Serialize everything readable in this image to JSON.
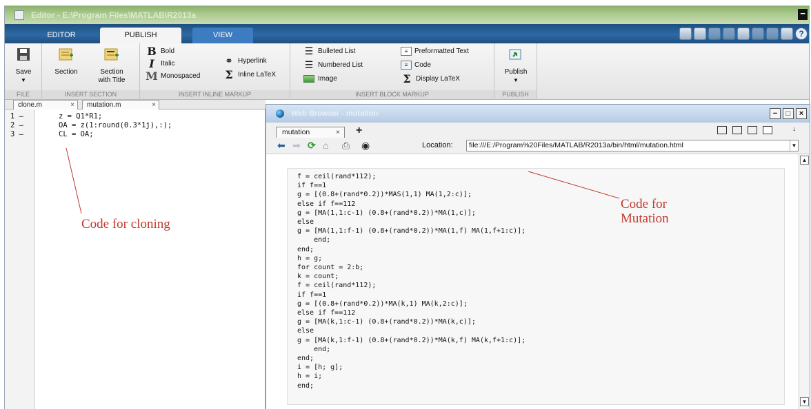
{
  "window": {
    "title": "Editor - E:\\Program Files\\MATLAB\\R2013a"
  },
  "ribbon_tabs": [
    "EDITOR",
    "PUBLISH",
    "VIEW"
  ],
  "ribbon": {
    "file": {
      "save": "Save",
      "label": "FILE"
    },
    "insert_section": {
      "section": "Section",
      "section_with_title_1": "Section",
      "section_with_title_2": "with Title",
      "label": "INSERT SECTION"
    },
    "inline_markup": {
      "bold": "Bold",
      "italic": "Italic",
      "monospaced": "Monospaced",
      "hyperlink": "Hyperlink",
      "inline_latex": "Inline LaTeX",
      "label": "INSERT INLINE MARKUP"
    },
    "block_markup": {
      "bulleted_list": "Bulleted List",
      "numbered_list": "Numbered List",
      "image": "Image",
      "preformatted_text": "Preformatted Text",
      "code": "Code",
      "display_latex": "Display LaTeX",
      "label": "INSERT BLOCK MARKUP"
    },
    "publish": {
      "publish": "Publish",
      "label": "PUBLISH"
    }
  },
  "doc_tabs": [
    "clone.m",
    "mutation.m"
  ],
  "editor": {
    "line_numbers": [
      "1 —",
      "2 —",
      "3 —"
    ],
    "lines": [
      "z = Q1*R1;",
      "OA = z(1:round(0.3*1j),:);",
      "CL = OA;"
    ]
  },
  "browser": {
    "title": "Web Browser - mutation",
    "tab": "mutation",
    "location_label": "Location:",
    "location_url": "file:///E:/Program%20Files/MATLAB/R2013a/bin/html/mutation.html",
    "code_lines": [
      "f = ceil(rand*112);",
      "if f==1",
      "g = [(0.8+(rand*0.2))*MAS(1,1) MA(1,2:c)];",
      "else if f==112",
      "g = [MA(1,1:c-1) (0.8+(rand*0.2))*MA(1,c)];",
      "else",
      "g = [MA(1,1:f-1) (0.8+(rand*0.2))*MA(1,f) MA(1,f+1:c)];",
      "    end;",
      "end;",
      "h = g;",
      "for count = 2:b;",
      "k = count;",
      "f = ceil(rand*112);",
      "if f==1",
      "g = [(0.8+(rand*0.2))*MA(k,1) MA(k,2:c)];",
      "else if f==112",
      "g = [MA(k,1:c-1) (0.8+(rand*0.2))*MA(k,c)];",
      "else",
      "g = [MA(k,1:f-1) (0.8+(rand*0.2))*MA(k,f) MA(k,f+1:c)];",
      "    end;",
      "end;",
      "i = [h; g];",
      "h = i;",
      "end;"
    ]
  },
  "annotations": {
    "cloning": "Code for cloning",
    "mutation_1": "Code for",
    "mutation_2": "Mutation"
  },
  "colors": {
    "annotation": "#c0392b",
    "ribbon_blue": "#2c6aa5",
    "titlebar_green": "#a8c98a"
  }
}
